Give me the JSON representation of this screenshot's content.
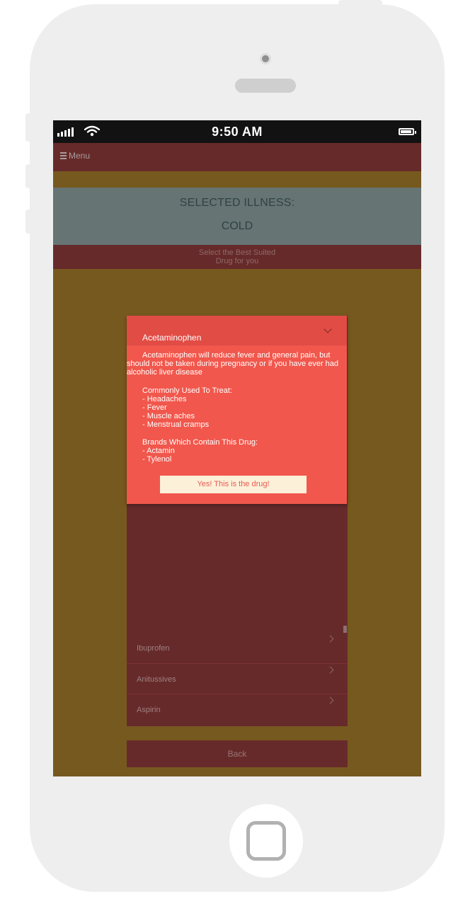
{
  "status_bar": {
    "time": "9:50 AM"
  },
  "header": {
    "menu_label": "Menu"
  },
  "illness": {
    "title": "SELECTED ILLNESS:",
    "name": "COLD"
  },
  "instruction": {
    "line1": "Select the Best Suited",
    "line2": "Drug for you"
  },
  "selected_drug": {
    "name": "Acetaminophen",
    "description": "Acetaminophen will reduce fever and general pain, but should not be taken during pregnancy or if you have ever had alcoholic liver disease",
    "treats_heading": "Commonly Used To Treat:",
    "treats": [
      "- Headaches",
      "- Fever",
      "- Muscle aches",
      "- Menstrual cramps"
    ],
    "brands_heading": "Brands Which Contain This Drug:",
    "brands": [
      "- Actamin",
      "- Tylenol"
    ],
    "confirm_label": "Yes! This is the drug!"
  },
  "drug_list": [
    {
      "name": "Ibuprofen"
    },
    {
      "name": "Anitussives"
    },
    {
      "name": "Aspirin"
    }
  ],
  "back_label": "Back",
  "colors": {
    "screen_bg": "#76591f",
    "header_bg": "#672a2a",
    "illness_panel_bg": "#667474",
    "popup_bg": "#f1574c",
    "confirm_button_bg": "#fdf0d9"
  }
}
